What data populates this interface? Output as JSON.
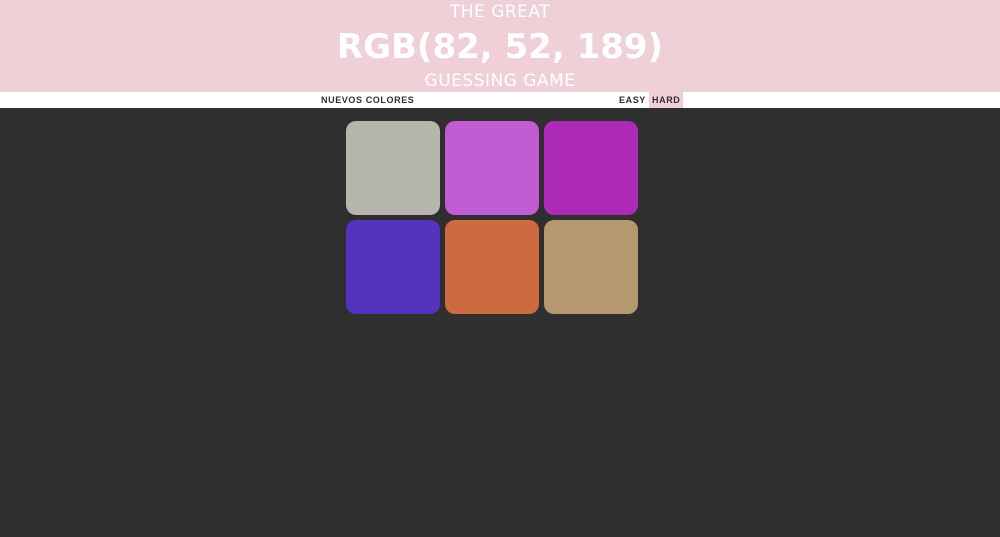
{
  "header": {
    "title_top": "THE GREAT",
    "rgb": "RGB(82, 52, 189)",
    "title_bottom": "GUESSING GAME"
  },
  "stripe": {
    "new_colors": "NUEVOS COLORES",
    "message": "",
    "easy": "EASY",
    "hard": "HARD"
  },
  "mode_selected": "hard",
  "squares": [
    {
      "color": "#b6b6ae"
    },
    {
      "color": "#c25cd2"
    },
    {
      "color": "#ae2bb7"
    },
    {
      "color": "#5234bd"
    },
    {
      "color": "#cd6a3f"
    },
    {
      "color": "#b59870"
    }
  ],
  "colors": {
    "header_bg": "#efd0d6",
    "body_bg": "#2f2f2f",
    "selected_mode_bg": "#efd0d6"
  }
}
